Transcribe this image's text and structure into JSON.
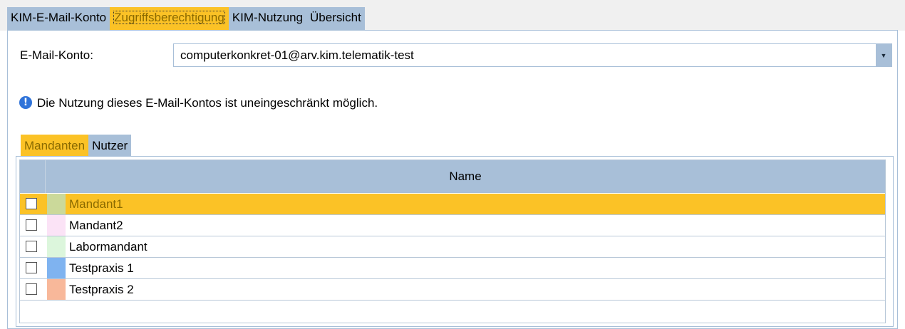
{
  "tabs": [
    {
      "label": "KIM-E-Mail-Konto",
      "active": false
    },
    {
      "label": "Zugriffsberechtigung",
      "active": true
    },
    {
      "label": "KIM-Nutzung",
      "active": false
    },
    {
      "label": "Übersicht",
      "active": false
    }
  ],
  "account": {
    "label": "E-Mail-Konto:",
    "value": "computerkonkret-01@arv.kim.telematik-test"
  },
  "info": {
    "icon": "info-icon",
    "text": "Die Nutzung dieses E-Mail-Kontos ist uneingeschränkt möglich."
  },
  "subtabs": [
    {
      "label": "Mandanten",
      "active": true
    },
    {
      "label": "Nutzer",
      "active": false
    }
  ],
  "table": {
    "column_header": "Name",
    "rows": [
      {
        "label": "Mandant1",
        "color": "#cbd99a",
        "selected": true,
        "checked": false
      },
      {
        "label": "Mandant2",
        "color": "#fbe3f6",
        "selected": false,
        "checked": false
      },
      {
        "label": "Labormandant",
        "color": "#dcf6dc",
        "selected": false,
        "checked": false
      },
      {
        "label": "Testpraxis 1",
        "color": "#7fb3f0",
        "selected": false,
        "checked": false
      },
      {
        "label": "Testpraxis 2",
        "color": "#f8b89a",
        "selected": false,
        "checked": false
      }
    ]
  },
  "colors": {
    "accent": "#fbc226",
    "tab_bg": "#a8bfd8"
  }
}
